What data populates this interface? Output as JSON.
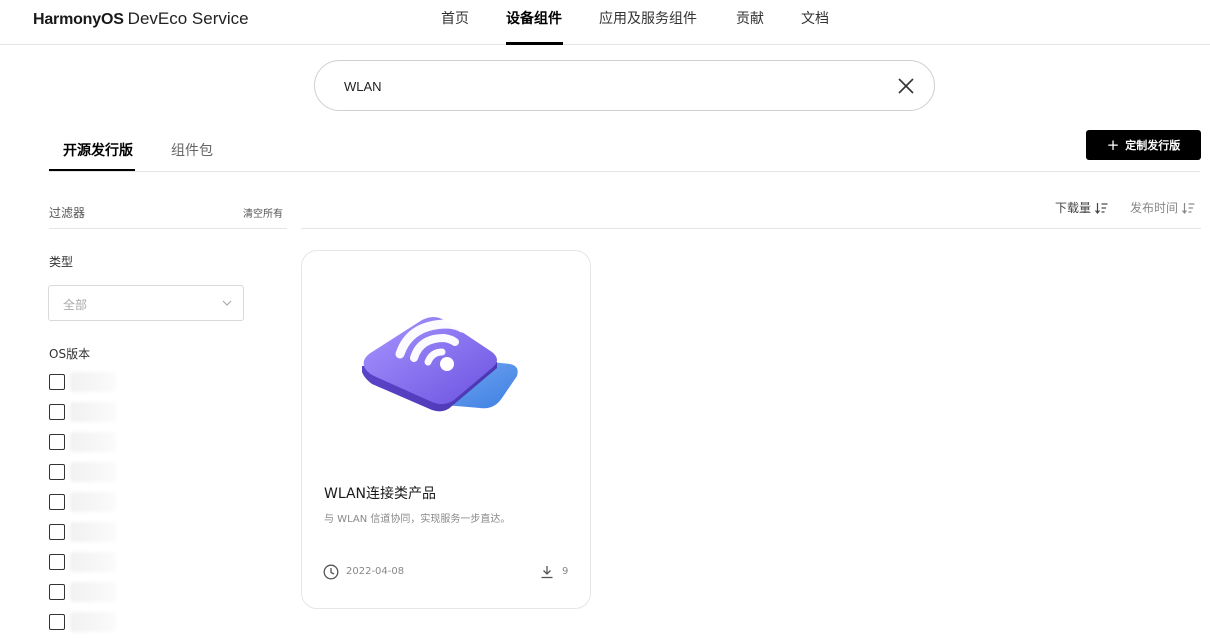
{
  "header": {
    "brand": "HarmonyOS",
    "product": "DevEco Service",
    "nav": [
      "首页",
      "设备组件",
      "应用及服务组件",
      "贡献",
      "文档"
    ],
    "active_nav": "设备组件"
  },
  "search": {
    "value": "WLAN",
    "clear_icon": "close-icon"
  },
  "tabs": [
    "开源发行版",
    "组件包"
  ],
  "active_tab": "开源发行版",
  "custom_button": {
    "label": "定制发行版",
    "icon": "plus-icon"
  },
  "filter": {
    "title": "过滤器",
    "clear_all": "清空所有",
    "type_label": "类型",
    "type_value": "全部",
    "os_label": "OS版本"
  },
  "sort": {
    "downloads": "下载量",
    "publish_time": "发布时间"
  },
  "card": {
    "title": "WLAN连接类产品",
    "description": "与 WLAN 信道协同，实现服务一步直达。",
    "date": "2022-04-08",
    "downloads": "9",
    "image_icon": "wifi-icon"
  },
  "colors": {
    "accent": "#000000",
    "card_purple": "#7a63e8",
    "card_blue": "#4d8fe8"
  }
}
